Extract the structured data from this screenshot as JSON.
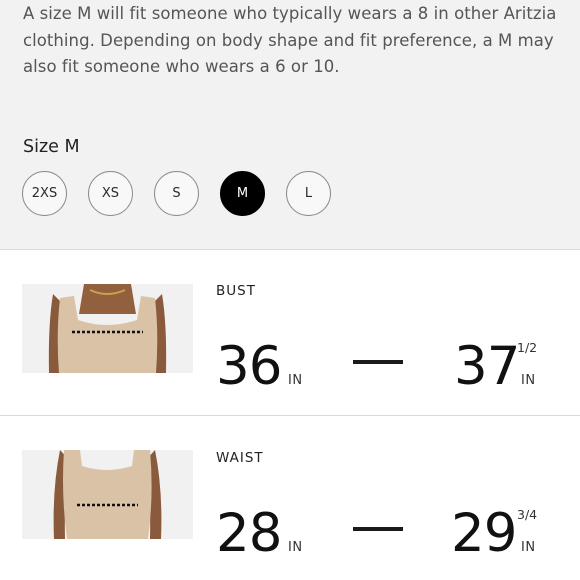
{
  "fit_description": "A size M will fit someone who typically wears a 8 in other Aritzia clothing. Depending on body shape and fit preference, a M may also fit someone who wears a 6 or 10.",
  "size_heading": "Size M",
  "sizes": [
    {
      "label": "2XS",
      "selected": false
    },
    {
      "label": "XS",
      "selected": false
    },
    {
      "label": "S",
      "selected": false
    },
    {
      "label": "M",
      "selected": true
    },
    {
      "label": "L",
      "selected": false
    }
  ],
  "measurements": [
    {
      "label": "BUST",
      "min": "36",
      "min_unit": "IN",
      "max": "37",
      "max_fraction": "1/2",
      "max_unit": "IN"
    },
    {
      "label": "WAIST",
      "min": "28",
      "min_unit": "IN",
      "max": "29",
      "max_fraction": "3/4",
      "max_unit": "IN"
    }
  ],
  "colors": {
    "accent": "#000000",
    "panel_bg": "#f2f2f2",
    "garment": "#d9c2a6",
    "skin": "#8a5a3c"
  }
}
